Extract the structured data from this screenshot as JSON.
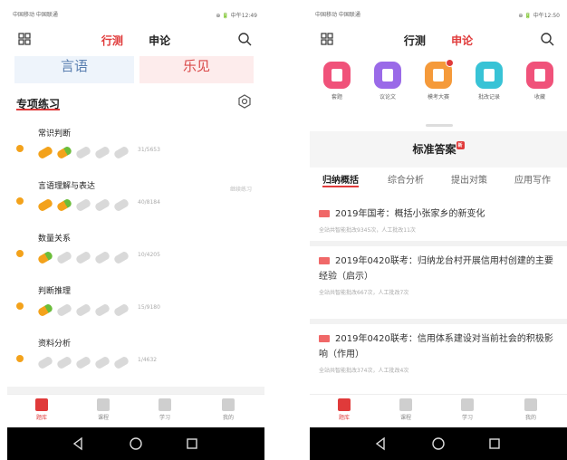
{
  "left": {
    "status": {
      "left": "中国移动 中国联通",
      "right": "⊕ 🔋 中午12:49"
    },
    "tabs": {
      "active": "行测",
      "inactive": "申论"
    },
    "banner": {
      "left": "言语",
      "right": "乐见"
    },
    "section_title": "专项练习",
    "items": [
      {
        "name": "常识判断",
        "progress": "31/5653",
        "flag": "",
        "filled": 2
      },
      {
        "name": "言语理解与表达",
        "progress": "40/8184",
        "flag": "继续练习",
        "filled": 2
      },
      {
        "name": "数量关系",
        "progress": "10/4205",
        "flag": "",
        "filled": 1
      },
      {
        "name": "判断推理",
        "progress": "15/9180",
        "flag": "",
        "filled": 1
      },
      {
        "name": "资料分析",
        "progress": "1/4632",
        "flag": "",
        "filled": 0
      }
    ],
    "nav": [
      "题库",
      "课程",
      "学习",
      "我的"
    ]
  },
  "right": {
    "status": {
      "left": "中国移动 中国联通",
      "right": "⊕ 🔋 中午12:50"
    },
    "tabs": {
      "inactive": "行测",
      "active": "申论"
    },
    "icons": [
      {
        "label": "套题",
        "color": "#f0527a"
      },
      {
        "label": "议论文",
        "color": "#9a6ae8"
      },
      {
        "label": "模考大赛",
        "color": "#f59a3a"
      },
      {
        "label": "批改记录",
        "color": "#38c3d6"
      },
      {
        "label": "收藏",
        "color": "#f0527a"
      }
    ],
    "std_title": "标准答案",
    "std_badge": "新",
    "subtabs": [
      "归纳概括",
      "综合分析",
      "提出对策",
      "应用写作"
    ],
    "entries": [
      {
        "title": "2019年国考：概括小张家乡的新变化",
        "meta": "全站共智能批改9345次，人工批改11次"
      },
      {
        "title": "2019年0420联考：归纳龙台村开展信用村创建的主要经验（启示）",
        "meta": "全站共智能批改667次，人工批改7次"
      },
      {
        "title": "2019年0420联考：信用体系建设对当前社会的积极影响（作用）",
        "meta": "全站共智能批改374次，人工批改4次"
      }
    ],
    "nav": [
      "题库",
      "课程",
      "学习",
      "我的"
    ]
  },
  "colors": {
    "accent": "#e03a3a",
    "pen": "#f3a21b"
  }
}
